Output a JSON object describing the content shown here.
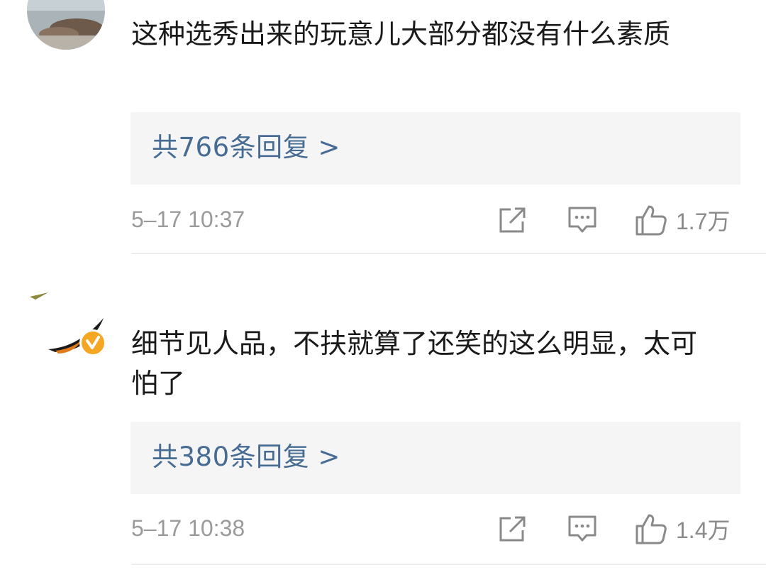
{
  "comments": [
    {
      "username": "",
      "text": "这种选秀出来的玩意儿大部分都没有什么素质",
      "replies_label": "共766条回复 >",
      "timestamp": "5–17 10:37",
      "likes": "1.7万"
    },
    {
      "username": "",
      "text": "细节见人品，不扶就算了还笑的这么明显，太可怕了",
      "replies_label": "共380条回复 >",
      "timestamp": "5–17 10:38",
      "likes": "1.4万",
      "verified": true
    }
  ],
  "icons": {
    "share": "share-icon",
    "comment": "comment-icon",
    "like": "thumbs-up-icon",
    "verified": "verified-badge-icon"
  },
  "colors": {
    "link": "#476c93",
    "reply_bg": "#f5f5f5",
    "meta_text": "#9a9a9a",
    "verified_badge": "#f5a623"
  }
}
